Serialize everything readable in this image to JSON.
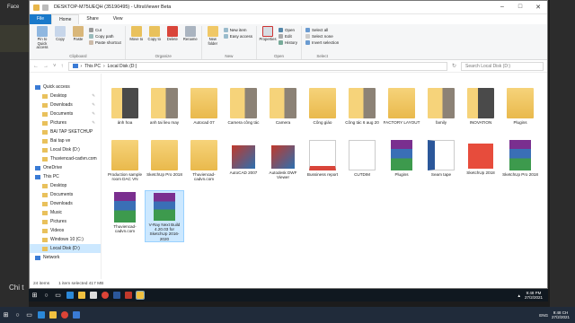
{
  "window": {
    "title": "DESKTOP-M75UEQH (35190495) - UltraViewer Beta"
  },
  "background": {
    "top_text": "Face",
    "bottom_text": "Chi t"
  },
  "ribbon": {
    "tabs": [
      "File",
      "Home",
      "Share",
      "View"
    ],
    "clipboard": {
      "pin": "Pin to Quick access",
      "copy": "Copy",
      "paste": "Paste",
      "cut": "Cut",
      "copy_path": "Copy path",
      "paste_shortcut": "Paste shortcut",
      "label": "Clipboard"
    },
    "organize": {
      "move_to": "Move to",
      "copy_to": "Copy to",
      "delete": "Delete",
      "rename": "Rename",
      "label": "Organize"
    },
    "new": {
      "new_folder": "New folder",
      "new_item": "New item",
      "easy_access": "Easy access",
      "label": "New"
    },
    "open": {
      "properties": "Properties",
      "open": "Open",
      "edit": "Edit",
      "history": "History",
      "label": "Open"
    },
    "select": {
      "select_all": "Select all",
      "select_none": "Select none",
      "invert": "Invert selection",
      "label": "Select"
    }
  },
  "address": {
    "crumbs": [
      "This PC",
      "Local Disk (D:)"
    ],
    "search_placeholder": "Search Local Disk (D:)"
  },
  "nav": [
    {
      "label": "Quick access",
      "indent": false,
      "pin": false
    },
    {
      "label": "Desktop",
      "indent": true,
      "pin": true
    },
    {
      "label": "Downloads",
      "indent": true,
      "pin": true
    },
    {
      "label": "Documents",
      "indent": true,
      "pin": true
    },
    {
      "label": "Pictures",
      "indent": true,
      "pin": true
    },
    {
      "label": "BAI TAP SKETCHUP",
      "indent": true,
      "pin": false
    },
    {
      "label": "Bai tap ve",
      "indent": true,
      "pin": false
    },
    {
      "label": "Local Disk (D:)",
      "indent": true,
      "pin": false
    },
    {
      "label": "Thuviencad-cadvn.com",
      "indent": true,
      "pin": false
    },
    {
      "label": "OneDrive",
      "indent": false,
      "pin": false
    },
    {
      "label": "This PC",
      "indent": false,
      "pin": false
    },
    {
      "label": "Desktop",
      "indent": true,
      "pin": false
    },
    {
      "label": "Documents",
      "indent": true,
      "pin": false
    },
    {
      "label": "Downloads",
      "indent": true,
      "pin": false
    },
    {
      "label": "Music",
      "indent": true,
      "pin": false
    },
    {
      "label": "Pictures",
      "indent": true,
      "pin": false
    },
    {
      "label": "Videos",
      "indent": true,
      "pin": false
    },
    {
      "label": "Windows 10 (C:)",
      "indent": true,
      "pin": false
    },
    {
      "label": "Local Disk (D:)",
      "indent": true,
      "pin": false
    },
    {
      "label": "Network",
      "indent": false,
      "pin": false
    }
  ],
  "files": [
    {
      "name": "ảnh hoa",
      "kind": "folder-pic2"
    },
    {
      "name": "anh tai lieu may",
      "kind": "folder-pic"
    },
    {
      "name": "Autocad 07",
      "kind": "folder"
    },
    {
      "name": "Camera công tác",
      "kind": "folder-pic"
    },
    {
      "name": "Camera",
      "kind": "folder-pic"
    },
    {
      "name": "Công giáo",
      "kind": "folder"
    },
    {
      "name": "Công tác 6 aug 20",
      "kind": "folder-pic"
    },
    {
      "name": "FACTORY LAYOUT",
      "kind": "folder"
    },
    {
      "name": "family",
      "kind": "folder-pic"
    },
    {
      "name": "INOVATION",
      "kind": "folder-pic2"
    },
    {
      "name": "Plugins",
      "kind": "folder"
    },
    {
      "name": "Production sample room DAC VN",
      "kind": "folder"
    },
    {
      "name": "SketchUp Pro 2018",
      "kind": "folder"
    },
    {
      "name": "Thuviencad-cadvn.com",
      "kind": "folder"
    },
    {
      "name": "AutoCAD 2007",
      "kind": "app"
    },
    {
      "name": "Autodesk DWF Viewer",
      "kind": "app"
    },
    {
      "name": "Bussiness report",
      "kind": "pdf"
    },
    {
      "name": "CUTDIM",
      "kind": "doc"
    },
    {
      "name": "Plugins",
      "kind": "rar"
    },
    {
      "name": "Seam tape",
      "kind": "word"
    },
    {
      "name": "SketchUp 2018",
      "kind": "sketchup"
    },
    {
      "name": "SketchUp Pro 2018",
      "kind": "rar"
    },
    {
      "name": "Thuviencad-cadvn.com",
      "kind": "rar"
    },
    {
      "name": "V-Ray Next Build 4.20.03 for SketchUp 2016-2020",
      "kind": "rar",
      "selected": true
    }
  ],
  "status": {
    "count": "24 items",
    "selected": "1 item selected  417 MB"
  },
  "clock": {
    "time": "9:48 PM",
    "date": "27/2/2021",
    "lang": "ENG",
    "outer_time": "9:48 CH",
    "outer_date": "27/2/2021"
  }
}
